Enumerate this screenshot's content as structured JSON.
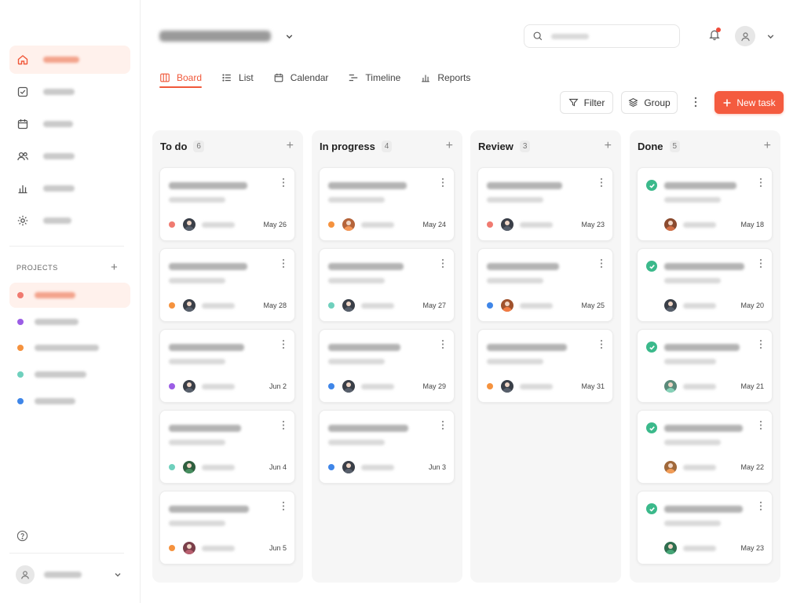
{
  "window": {
    "dot_colors": [
      "#ff5f57",
      "#febc2e",
      "#28c840"
    ]
  },
  "sidebar": {
    "nav_items": [
      {
        "icon": "home-icon",
        "active": true
      },
      {
        "icon": "checkbox-icon",
        "active": false
      },
      {
        "icon": "calendar-icon",
        "active": false
      },
      {
        "icon": "users-icon",
        "active": false
      },
      {
        "icon": "bar-chart-icon",
        "active": false
      },
      {
        "icon": "gear-icon",
        "active": false
      }
    ],
    "projects_label": "PROJECTS",
    "projects_add": "+",
    "projects": [
      {
        "color": "#f07a70",
        "active": true
      },
      {
        "color": "#9b5de5",
        "active": false
      },
      {
        "color": "#f5923e",
        "active": false
      },
      {
        "color": "#6fd0bd",
        "active": false
      },
      {
        "color": "#3f86e8",
        "active": false
      }
    ],
    "help_icon": "help-circle-icon",
    "user_avatar_icon": "user-icon"
  },
  "header": {
    "search_icon": "search-icon",
    "bell_icon": "bell-icon",
    "notification_color": "#ef4b3a"
  },
  "tabs": [
    {
      "label": "Board",
      "icon": "board-icon",
      "active": true
    },
    {
      "label": "List",
      "icon": "list-icon",
      "active": false
    },
    {
      "label": "Calendar",
      "icon": "calendar-icon",
      "active": false
    },
    {
      "label": "Timeline",
      "icon": "timeline-icon",
      "active": false
    },
    {
      "label": "Reports",
      "icon": "bar-chart-icon",
      "active": false
    }
  ],
  "toolbar": {
    "filter_label": "Filter",
    "group_label": "Group",
    "new_task_label": "New task",
    "accent_color": "#f45b3f"
  },
  "columns": [
    {
      "title": "To do",
      "count": "6",
      "add": "+",
      "done": false,
      "cards": [
        {
          "dot": "#f07a70",
          "avatar": "#3a3f48",
          "date": "May 26"
        },
        {
          "dot": "#f5923e",
          "avatar": "#3a3f48",
          "date": "May 28"
        },
        {
          "dot": "#9b5de5",
          "avatar": "#3a3f48",
          "date": "Jun 2"
        },
        {
          "dot": "#6fd0bd",
          "avatar": "#2f5e3f",
          "date": "Jun 4"
        },
        {
          "dot": "#f5923e",
          "avatar": "#7a3f4a",
          "date": "Jun 5"
        }
      ]
    },
    {
      "title": "In progress",
      "count": "4",
      "add": "+",
      "done": false,
      "cards": [
        {
          "dot": "#f5923e",
          "avatar": "#b5643a",
          "date": "May 24"
        },
        {
          "dot": "#6fd0bd",
          "avatar": "#3a3f48",
          "date": "May 27"
        },
        {
          "dot": "#3f86e8",
          "avatar": "#3a3f48",
          "date": "May 29"
        },
        {
          "dot": "#3f86e8",
          "avatar": "#3a3f48",
          "date": "Jun 3"
        }
      ]
    },
    {
      "title": "Review",
      "count": "3",
      "add": "+",
      "done": false,
      "cards": [
        {
          "dot": "#f07a70",
          "avatar": "#3a3f48",
          "date": "May 23"
        },
        {
          "dot": "#3f86e8",
          "avatar": "#a0522d",
          "date": "May 25"
        },
        {
          "dot": "#f5923e",
          "avatar": "#3a3f48",
          "date": "May 31"
        }
      ]
    },
    {
      "title": "Done",
      "count": "5",
      "add": "+",
      "done": true,
      "cards": [
        {
          "dot": "",
          "avatar": "#8a4a2e",
          "date": "May 18"
        },
        {
          "dot": "",
          "avatar": "#3a3f48",
          "date": "May 20"
        },
        {
          "dot": "",
          "avatar": "#5a8a7a",
          "date": "May 21"
        },
        {
          "dot": "",
          "avatar": "#a0683a",
          "date": "May 22"
        },
        {
          "dot": "",
          "avatar": "#2f6e4f",
          "date": "May 23"
        }
      ]
    }
  ]
}
